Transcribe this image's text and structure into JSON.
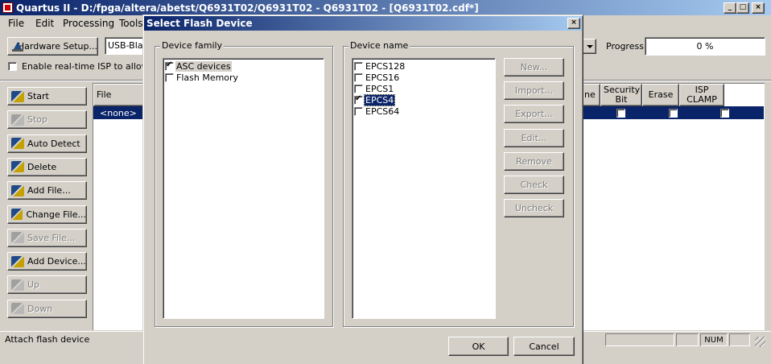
{
  "main_window": {
    "title": "Quartus II - D:/fpga/altera/abetst/Q6931T02/Q6931T02 - Q6931T02 - [Q6931T02.cdf*]",
    "controls": {
      "minimize": "_",
      "maximize": "□",
      "close": "×"
    }
  },
  "menu": [
    "File",
    "Edit",
    "Processing",
    "Tools"
  ],
  "toolbar": {
    "hardware_setup_label": "Hardware Setup...",
    "hardware_value": "USB-Blas",
    "progress_label": "Progress:",
    "progress_value": "0 %",
    "isp_checkbox_label": "Enable real-time ISP to allow ba"
  },
  "side_buttons": [
    {
      "label": "Start",
      "enabled": true,
      "icon": "start-icon"
    },
    {
      "label": "Stop",
      "enabled": false,
      "icon": "stop-icon"
    },
    {
      "label": "Auto Detect",
      "enabled": true,
      "icon": "auto-detect-icon"
    },
    {
      "label": "Delete",
      "enabled": true,
      "icon": "delete-icon"
    },
    {
      "label": "Add File...",
      "enabled": true,
      "icon": "add-file-icon"
    },
    {
      "label": "Change File...",
      "enabled": true,
      "icon": "change-file-icon"
    },
    {
      "label": "Save File...",
      "enabled": false,
      "icon": "save-file-icon"
    },
    {
      "label": "Add Device...",
      "enabled": true,
      "icon": "add-device-icon"
    },
    {
      "label": "Up",
      "enabled": false,
      "icon": "up-arrow-icon"
    },
    {
      "label": "Down",
      "enabled": false,
      "icon": "down-arrow-icon"
    }
  ],
  "table": {
    "file_header": "File",
    "row_file": "<none>",
    "partial_header": "ne",
    "security_header": "Security Bit",
    "erase_header": "Erase",
    "isp_header": "ISP CLAMP"
  },
  "status_bar": {
    "message": "Attach flash device",
    "num": "NUM"
  },
  "dialog": {
    "title": "Select Flash Device",
    "close": "×",
    "device_family_label": "Device family",
    "device_family_items": [
      {
        "label": "ASC devices",
        "checked": true
      },
      {
        "label": "Flash Memory",
        "checked": false
      }
    ],
    "device_name_label": "Device name",
    "device_name_items": [
      {
        "label": "EPCS128",
        "checked": false
      },
      {
        "label": "EPCS16",
        "checked": false
      },
      {
        "label": "EPCS1",
        "checked": false
      },
      {
        "label": "EPCS4",
        "checked": true
      },
      {
        "label": "EPCS64",
        "checked": false
      }
    ],
    "buttons": [
      {
        "label": "New...",
        "enabled": false
      },
      {
        "label": "Import...",
        "enabled": false
      },
      {
        "label": "Export...",
        "enabled": false
      },
      {
        "label": "Edit...",
        "enabled": false
      },
      {
        "label": "Remove",
        "enabled": false
      },
      {
        "label": "Check",
        "enabled": false
      },
      {
        "label": "Uncheck",
        "enabled": false
      }
    ],
    "ok_label": "OK",
    "cancel_label": "Cancel"
  },
  "colors": {
    "title_active": "#0a246a",
    "face": "#d4d0c8",
    "selection": "#0a246a"
  }
}
